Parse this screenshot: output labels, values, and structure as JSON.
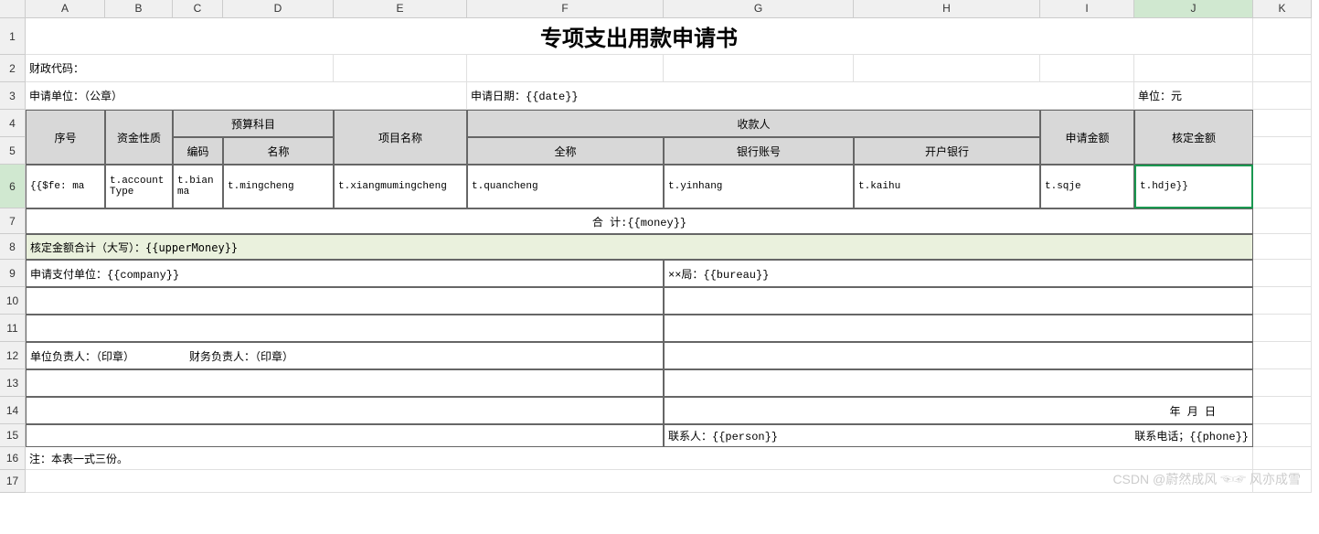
{
  "columns": [
    "A",
    "B",
    "C",
    "D",
    "E",
    "F",
    "G",
    "H",
    "I",
    "J",
    "K"
  ],
  "rows": [
    "1",
    "2",
    "3",
    "4",
    "5",
    "6",
    "7",
    "8",
    "9",
    "10",
    "11",
    "12",
    "13",
    "14",
    "15",
    "16",
    "17"
  ],
  "selected_column": "J",
  "selected_row": "6",
  "title": "专项支出用款申请书",
  "info": {
    "finance_code_label": "财政代码：",
    "apply_unit_label": "申请单位：（公章）",
    "apply_date_label": "申请日期：{{date}}",
    "unit_label": "单位：元"
  },
  "headers": {
    "seq": "序号",
    "fund_nature": "资金性质",
    "budget_subject": "预算科目",
    "code": "编码",
    "name": "名称",
    "project_name": "项目名称",
    "payee": "收款人",
    "full_name": "全称",
    "bank_account": "银行账号",
    "open_bank": "开户银行",
    "apply_amount": "申请金额",
    "approved_amount": "核定金额"
  },
  "data_row": {
    "a": "{{$fe: ma",
    "b": "t.accountType",
    "c": "t.bianma",
    "d": "t.mingcheng",
    "e": "t.xiangmumingcheng",
    "f": "t.quancheng",
    "g": "t.yinhang",
    "h": "t.kaihu",
    "i": "t.sqje",
    "j": "t.hdje}}"
  },
  "total_row": "合            计:{{money}}",
  "upper_money": "核定金额合计（大写）：{{upperMoney}}",
  "apply_pay_unit": "申请支付单位：{{company}}",
  "bureau": "××局：{{bureau}}",
  "unit_leader": "单位负责人：（印章）",
  "finance_leader": "财务负责人：（印章）",
  "date_ymd": "年    月    日",
  "contact_person": "联系人：{{person}}",
  "contact_phone": "联系电话；{{phone}}",
  "note": "注：本表一式三份。",
  "watermark": "CSDN @蔚然成风 ☜☞ 风亦成雪"
}
